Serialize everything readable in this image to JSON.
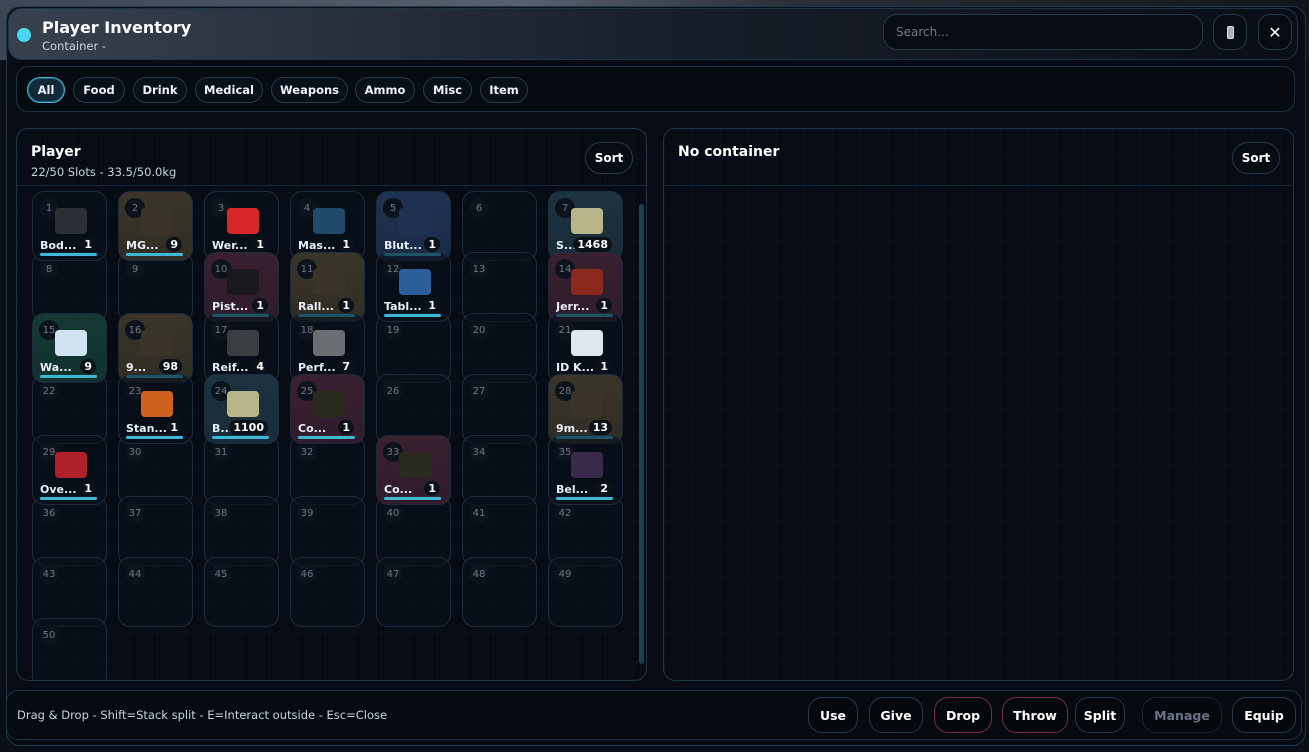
{
  "header": {
    "title": "Player Inventory",
    "subtitle": "Container -",
    "search_placeholder": "Search...",
    "close_label": "✕"
  },
  "filters": [
    "All",
    "Food",
    "Drink",
    "Medical",
    "Weapons",
    "Ammo",
    "Misc",
    "Item"
  ],
  "player": {
    "title": "Player",
    "meta": "22/50 Slots - 33.5/50.0kg",
    "sort_label": "Sort",
    "total_slots": 50
  },
  "container": {
    "title": "No container",
    "sort_label": "Sort"
  },
  "items": [
    {
      "slot": 1,
      "name": "Bod...",
      "count": "1",
      "tint": "none",
      "icon": "body-armor-icon",
      "iconColor": "#2a2e35"
    },
    {
      "slot": 2,
      "name": "MG...",
      "count": "9",
      "tint": "#3a3528",
      "icon": "ammo-icon",
      "iconColor": "#3a3528"
    },
    {
      "slot": 3,
      "name": "Wer...",
      "count": "1",
      "tint": "none",
      "icon": "toolbox-icon",
      "iconColor": "#d8262a"
    },
    {
      "slot": 4,
      "name": "Mas...",
      "count": "1",
      "tint": "none",
      "icon": "credit-card-icon",
      "iconColor": "#1f4a6a"
    },
    {
      "slot": 5,
      "name": "Blut...",
      "count": "1",
      "tint": "#1e3252",
      "icon": "blood-bag-icon",
      "iconColor": "#1e3252"
    },
    {
      "slot": 7,
      "name": "S...",
      "count": "1468",
      "tint": "#1c3440",
      "icon": "cash-roll-icon",
      "iconColor": "#b9b48a"
    },
    {
      "slot": 10,
      "name": "Pist...",
      "count": "1",
      "tint": "#3a2030",
      "icon": "pistol-icon",
      "iconColor": "#1a1a1e"
    },
    {
      "slot": 11,
      "name": "Rall...",
      "count": "1",
      "tint": "#3a3528",
      "icon": "item-icon",
      "iconColor": "#3a3528"
    },
    {
      "slot": 12,
      "name": "Tabl...",
      "count": "1",
      "tint": "none",
      "icon": "tablet-icon",
      "iconColor": "#2a5f9c"
    },
    {
      "slot": 14,
      "name": "Jerr...",
      "count": "1",
      "tint": "#3a2030",
      "icon": "jerry-can-icon",
      "iconColor": "#8a2a1e"
    },
    {
      "slot": 15,
      "name": "Wa...",
      "count": "9",
      "tint": "#143a34",
      "icon": "water-bottle-icon",
      "iconColor": "#cfe3f0"
    },
    {
      "slot": 16,
      "name": "9...",
      "count": "98",
      "tint": "#3a3528",
      "icon": "ammo-icon",
      "iconColor": "#3a3528"
    },
    {
      "slot": 17,
      "name": "Reif...",
      "count": "4",
      "tint": "none",
      "icon": "tire-icon",
      "iconColor": "#3a3d42"
    },
    {
      "slot": 18,
      "name": "Perf...",
      "count": "7",
      "tint": "none",
      "icon": "wheels-icon",
      "iconColor": "#6a6d72"
    },
    {
      "slot": 21,
      "name": "ID K...",
      "count": "1",
      "tint": "none",
      "icon": "id-card-icon",
      "iconColor": "#dfe6ee"
    },
    {
      "slot": 23,
      "name": "Stan...",
      "count": "1",
      "tint": "none",
      "icon": "flare-icon",
      "iconColor": "#d0601e"
    },
    {
      "slot": 24,
      "name": "B...",
      "count": "1100",
      "tint": "#1c3440",
      "icon": "cash-roll-icon",
      "iconColor": "#b9b48a"
    },
    {
      "slot": 25,
      "name": "Co...",
      "count": "1",
      "tint": "#3a2030",
      "icon": "rifle-icon",
      "iconColor": "#2a2a1e"
    },
    {
      "slot": 28,
      "name": "9m...",
      "count": "13",
      "tint": "#3a3528",
      "icon": "ammo-icon",
      "iconColor": "#3a3528"
    },
    {
      "slot": 29,
      "name": "Ove...",
      "count": "1",
      "tint": "none",
      "icon": "overlay-icon",
      "iconColor": "#b0202a"
    },
    {
      "slot": 33,
      "name": "Co...",
      "count": "1",
      "tint": "#3a2030",
      "icon": "rifle-icon",
      "iconColor": "#2a2a1e"
    },
    {
      "slot": 35,
      "name": "Bel...",
      "count": "2",
      "tint": "none",
      "icon": "lights-icon",
      "iconColor": "#3a2a4a"
    }
  ],
  "footer": {
    "hint": "Drag & Drop - Shift=Stack split - E=Interact outside - Esc=Close",
    "actions": [
      {
        "label": "Use",
        "style": "normal"
      },
      {
        "label": "Give",
        "style": "normal"
      },
      {
        "label": "Drop",
        "style": "danger"
      },
      {
        "label": "Throw",
        "style": "danger"
      },
      {
        "label": "Split",
        "style": "normal"
      },
      {
        "label": "Manage",
        "style": "disabled"
      },
      {
        "label": "Equip",
        "style": "normal"
      }
    ]
  }
}
